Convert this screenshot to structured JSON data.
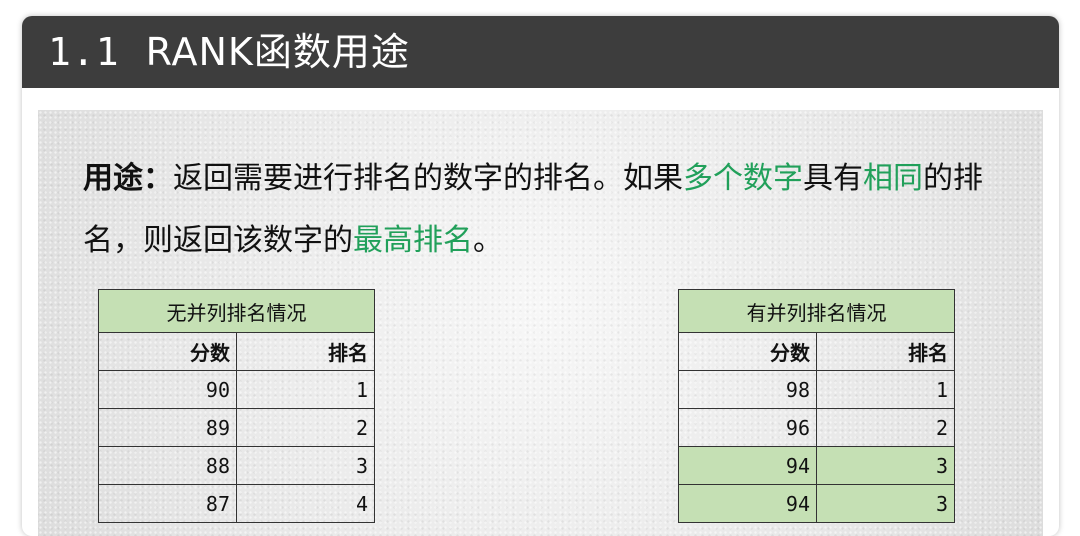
{
  "title": {
    "number": "1.1",
    "text": "RANK函数用途"
  },
  "description": {
    "label": "用途：",
    "part1": "返回需要进行排名的数字的排名。如果",
    "hl1": "多个数字",
    "part2": "具有",
    "hl2": "相同",
    "part3": "的排名，则返回该数字的",
    "hl3": "最高排名",
    "part4": "。"
  },
  "colors": {
    "title_bar": "#3d3d3d",
    "highlight_text": "#21a05a",
    "table_header_bg": "#c5e0b4"
  },
  "tables": {
    "left": {
      "caption": "无并列排名情况",
      "columns": [
        "分数",
        "排名"
      ],
      "rows": [
        {
          "score": "90",
          "rank": "1"
        },
        {
          "score": "89",
          "rank": "2"
        },
        {
          "score": "88",
          "rank": "3"
        },
        {
          "score": "87",
          "rank": "4"
        }
      ]
    },
    "right": {
      "caption": "有并列排名情况",
      "columns": [
        "分数",
        "排名"
      ],
      "rows": [
        {
          "score": "98",
          "rank": "1"
        },
        {
          "score": "96",
          "rank": "2"
        },
        {
          "score": "94",
          "rank": "3",
          "tie": true
        },
        {
          "score": "94",
          "rank": "3",
          "tie": true
        }
      ]
    }
  }
}
